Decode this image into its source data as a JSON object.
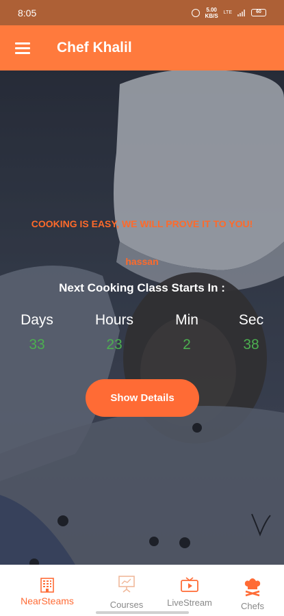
{
  "status_bar": {
    "time": "8:05",
    "net_speed_top": "5.00",
    "net_speed_bottom": "KB/S",
    "network": "LTE",
    "battery": "60"
  },
  "app_bar": {
    "title": "Chef Khalil"
  },
  "hero": {
    "tagline": "COOKING IS EASY, WE WILL PROVE IT TO YOU!",
    "username": "hassan",
    "next_class_heading": "Next Cooking Class Starts In :",
    "countdown": [
      {
        "label": "Days",
        "value": "33"
      },
      {
        "label": "Hours",
        "value": "23"
      },
      {
        "label": "Min",
        "value": "2"
      },
      {
        "label": "Sec",
        "value": "38"
      }
    ],
    "show_details_label": "Show Details",
    "accent_color": "#ff6b35",
    "countdown_color": "#4caf50"
  },
  "bottom_nav": {
    "items": [
      {
        "label": "NearSteams",
        "icon": "building-icon",
        "active": true
      },
      {
        "label": "Courses",
        "icon": "presentation-board-icon",
        "active": false
      },
      {
        "label": "LiveStream",
        "icon": "tv-play-icon",
        "active": false
      },
      {
        "label": "Chefs",
        "icon": "chef-hat-icon",
        "active": false
      }
    ]
  }
}
